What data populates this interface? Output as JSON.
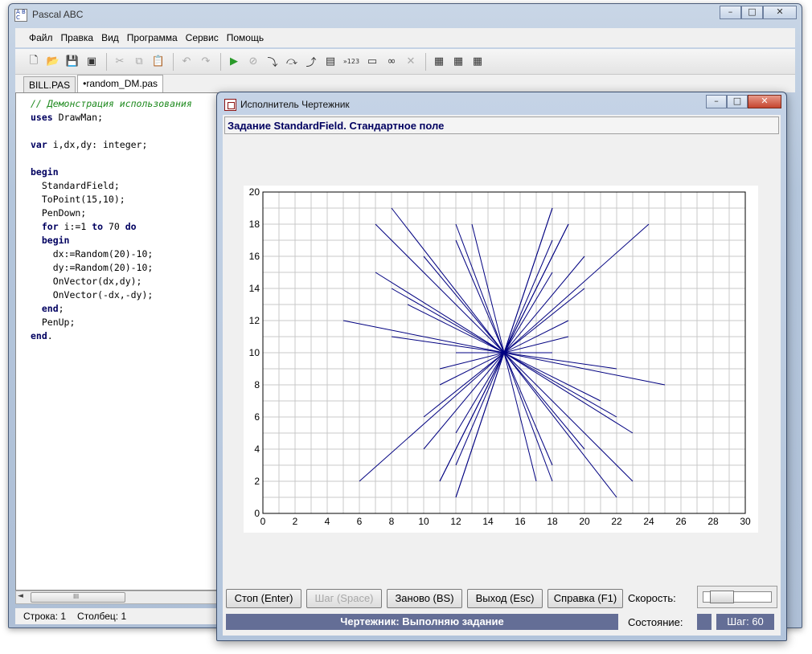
{
  "app": {
    "title": "Pascal ABC",
    "icon": "abc-app-icon"
  },
  "window_controls": {
    "minimize": "–",
    "maximize": "□",
    "close": "✕"
  },
  "menu": [
    "Файл",
    "Правка",
    "Вид",
    "Программа",
    "Сервис",
    "Помощь"
  ],
  "toolbar_icons": [
    "new-file-icon",
    "open-file-icon",
    "save-icon",
    "save-all-icon",
    "cut-icon",
    "copy-icon",
    "paste-icon",
    "undo-icon",
    "redo-icon",
    "run-icon",
    "stop-icon",
    "step-into-icon",
    "step-over-icon",
    "step-out-icon",
    "evaluate-icon",
    "watch-icon",
    "window-icon",
    "glasses-icon",
    "close-icon",
    "help-d-icon",
    "help-i-icon",
    "help-r-icon"
  ],
  "tabs": [
    {
      "label": "BILL.PAS",
      "active": false
    },
    {
      "label": "•random_DM.pas",
      "active": true
    }
  ],
  "editor": {
    "lines": [
      {
        "text": "// Демонстрация использования",
        "style": "cm"
      },
      {
        "text": "uses DrawMan;",
        "kw": "uses",
        "rest": " DrawMan;"
      },
      {
        "text": ""
      },
      {
        "text": "var i,dx,dy: integer;",
        "kw": "var",
        "rest": " i,dx,dy: integer;"
      },
      {
        "text": ""
      },
      {
        "text": "begin",
        "kw": "begin",
        "rest": ""
      },
      {
        "text": "  StandardField;"
      },
      {
        "text": "  ToPoint(15,10);"
      },
      {
        "text": "  PenDown;"
      },
      {
        "text": "  for i:=1 to 70 do",
        "parts": [
          [
            "  ",
            ""
          ],
          [
            "for",
            "kw"
          ],
          [
            " i:=1 ",
            ""
          ],
          [
            "to",
            "kw"
          ],
          [
            " 70 ",
            ""
          ],
          [
            "do",
            "kw"
          ]
        ]
      },
      {
        "text": "  begin",
        "parts": [
          [
            "  ",
            ""
          ],
          [
            "begin",
            "kw"
          ]
        ]
      },
      {
        "text": "    dx:=Random(20)-10;"
      },
      {
        "text": "    dy:=Random(20)-10;"
      },
      {
        "text": "    OnVector(dx,dy);"
      },
      {
        "text": "    OnVector(-dx,-dy);"
      },
      {
        "text": "  end;",
        "parts": [
          [
            "  ",
            ""
          ],
          [
            "end",
            "kw"
          ],
          [
            ";",
            ""
          ]
        ]
      },
      {
        "text": "  PenUp;"
      },
      {
        "text": "end.",
        "parts": [
          [
            "end",
            "kw"
          ],
          [
            ".",
            ""
          ]
        ]
      }
    ]
  },
  "hscroll": {
    "grip": "III"
  },
  "statusbar": {
    "line": "Строка: 1",
    "column": "Столбец: 1"
  },
  "child": {
    "title": "Исполнитель Чертежник",
    "task": "Задание StandardField. Стандартное поле",
    "buttons": {
      "stop": "Стоп (Enter)",
      "step": "Шаг (Space)",
      "restart": "Заново (BS)",
      "exit": "Выход (Esc)",
      "help": "Справка (F1)"
    },
    "speed_label": "Скорость:",
    "speed_level": 0.15,
    "status_text": "Чертежник: Выполняю задание",
    "state_label": "Состояние:",
    "step_text": "Шаг: 60"
  },
  "chart_data": {
    "type": "line",
    "title": "",
    "xlabel": "",
    "ylabel": "",
    "xlim": [
      0,
      30
    ],
    "ylim": [
      0,
      20
    ],
    "xticks": [
      0,
      2,
      4,
      6,
      8,
      10,
      12,
      14,
      16,
      18,
      20,
      22,
      24,
      26,
      28,
      30
    ],
    "yticks": [
      0,
      2,
      4,
      6,
      8,
      10,
      12,
      14,
      16,
      18,
      20
    ],
    "grid": true,
    "center": [
      15,
      10
    ],
    "line_color": "#000080",
    "segments": [
      [
        [
          8,
          19
        ],
        [
          22,
          1
        ]
      ],
      [
        [
          7,
          18
        ],
        [
          23,
          2
        ]
      ],
      [
        [
          7,
          15
        ],
        [
          23,
          5
        ]
      ],
      [
        [
          5,
          12
        ],
        [
          25,
          8
        ]
      ],
      [
        [
          9,
          13
        ],
        [
          21,
          7
        ]
      ],
      [
        [
          12,
          18
        ],
        [
          18,
          2
        ]
      ],
      [
        [
          13,
          18
        ],
        [
          17,
          2
        ]
      ],
      [
        [
          10,
          16
        ],
        [
          20,
          4
        ]
      ],
      [
        [
          11,
          9
        ],
        [
          19,
          11
        ]
      ],
      [
        [
          18,
          19
        ],
        [
          12,
          1
        ]
      ],
      [
        [
          19,
          18
        ],
        [
          11,
          2
        ]
      ],
      [
        [
          20,
          16
        ],
        [
          10,
          4
        ]
      ],
      [
        [
          19,
          12
        ],
        [
          11,
          8
        ]
      ],
      [
        [
          18,
          17
        ],
        [
          12,
          3
        ]
      ],
      [
        [
          18,
          15
        ],
        [
          12,
          5
        ]
      ],
      [
        [
          22,
          9
        ],
        [
          8,
          11
        ]
      ],
      [
        [
          22,
          6
        ],
        [
          8,
          14
        ]
      ],
      [
        [
          18,
          3
        ],
        [
          12,
          17
        ]
      ],
      [
        [
          6,
          2
        ],
        [
          24,
          18
        ]
      ],
      [
        [
          11,
          2
        ],
        [
          19,
          18
        ]
      ],
      [
        [
          10,
          6
        ],
        [
          20,
          14
        ]
      ],
      [
        [
          12,
          1
        ],
        [
          18,
          19
        ]
      ],
      [
        [
          18,
          10
        ],
        [
          12,
          10
        ]
      ]
    ]
  }
}
